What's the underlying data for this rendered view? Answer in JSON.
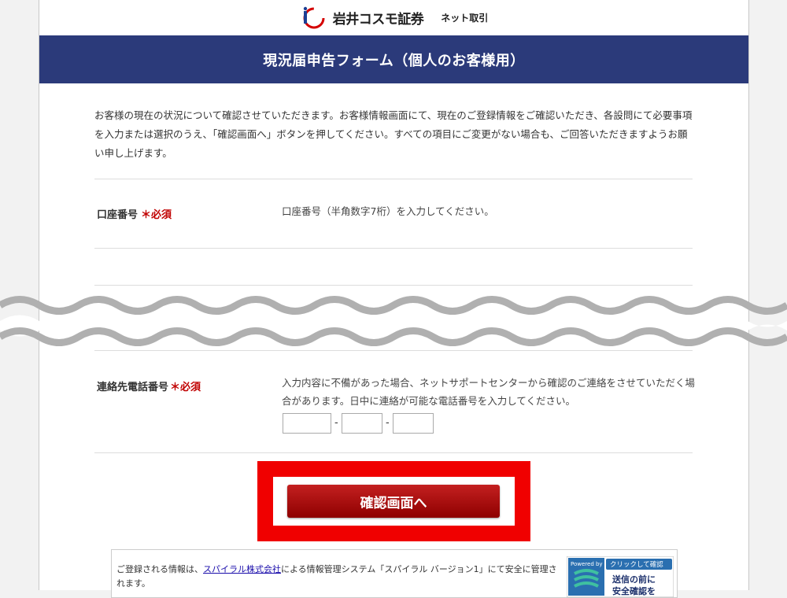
{
  "header": {
    "company_name": "岩井コスモ証券",
    "service_name": "ネット取引",
    "title": "現況届申告フォーム（個人のお客様用）"
  },
  "intro": {
    "text": "お客様の現在の状況について確認させていただきます。お客様情報画面にて、現在のご登録情報をご確認いただき、各設問にて必要事項を入力または選択のうえ、「確認画面へ」ボタンを押してください。すべての項目にご変更がない場合も、ご回答いただきますようお願い申し上げます。"
  },
  "fields": {
    "account": {
      "label": "口座番号",
      "required": "＊必須",
      "help": "口座番号（半角数字7桁）を入力してください。"
    },
    "phone": {
      "label": "連絡先電話番号",
      "required": "＊必須",
      "help": "入力内容に不備があった場合、ネットサポートセンターから確認のご連絡をさせていただく場合があります。日中に連絡が可能な電話番号を入力してください。",
      "separator": "-",
      "part1": "",
      "part2": "",
      "part3": ""
    }
  },
  "actions": {
    "confirm_label": "確認画面へ"
  },
  "footer": {
    "text_before": "ご登録される情報は、",
    "link": "スパイラル株式会社",
    "text_after": "による情報管理システム「スパイラル バージョン1」にて安全に管理されます。",
    "seal_powered": "Powered by",
    "seal_click": "クリックして確認",
    "seal_line1": "送信の前に",
    "seal_line2": "安全確認を"
  },
  "colors": {
    "title_band": "#2b3a7a",
    "required": "#c00000",
    "highlight": "#f00000",
    "button": "#a40000"
  }
}
